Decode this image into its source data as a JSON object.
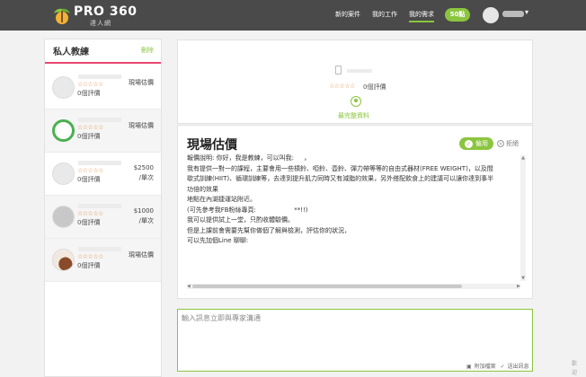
{
  "header": {
    "logo_text": "PRO 360",
    "logo_sub": "達人網",
    "nav": [
      {
        "label": "新的案件"
      },
      {
        "label": "我的工作"
      },
      {
        "label": "我的需求"
      }
    ],
    "points_label": "50點",
    "caret": "▾"
  },
  "sidebar": {
    "title": "私人教練",
    "delete_label": "刪除",
    "items": [
      {
        "stars": "☆☆☆☆☆",
        "reviews": "0個評價",
        "price": "現場估價",
        "unit": ""
      },
      {
        "stars": "☆☆☆☆☆",
        "reviews": "0個評價",
        "price": "現場估價",
        "unit": ""
      },
      {
        "stars": "☆☆☆☆☆",
        "reviews": "0個評價",
        "price": "$2500",
        "unit": "/單次"
      },
      {
        "stars": "☆☆☆☆☆",
        "reviews": "0個評價",
        "price": "$1000",
        "unit": "/單次"
      },
      {
        "stars": "☆☆☆☆☆",
        "reviews": "0個評價",
        "price": "現場估價",
        "unit": ""
      }
    ]
  },
  "profile": {
    "stars": "☆☆☆☆☆",
    "reviews": "0個評價",
    "link": "最完整資料"
  },
  "quote": {
    "title": "現場估價",
    "hire_label": "僱用",
    "reject_label": "拒絕",
    "reject_icon": "×",
    "lines": [
      "報價說明: 你好，我是教練，可以叫我:     ，",
      "",
      "我有提供一對一的課程，主要會用一些槓鈴、啞鈴、壺鈴、彈力帶等等的自由式器材(FREE WEIGHT)，以及間",
      "歇式訓練(HIIT)、循環訓練等，去達到提升肌力同時又有減脂的效果，另外搭配飲食上的建議可以讓你達到事半",
      "功倍的效果",
      "",
      "地點在內湖捷運站附近。",
      "(可先參考我FB粉絲專頁:                   **!!)",
      "",
      "我可以提供試上一堂，只酌收體驗價。",
      "但是上課前會需要先幫你做個了解與檢測，評估你的狀況，",
      "可以先加個Line 聊聊:"
    ]
  },
  "message": {
    "placeholder": "輸入訊息立即與專家溝通",
    "attach_label": "附加檔案",
    "send_label": "送出訊息"
  },
  "corner_text": [
    "歡",
    "迎"
  ]
}
